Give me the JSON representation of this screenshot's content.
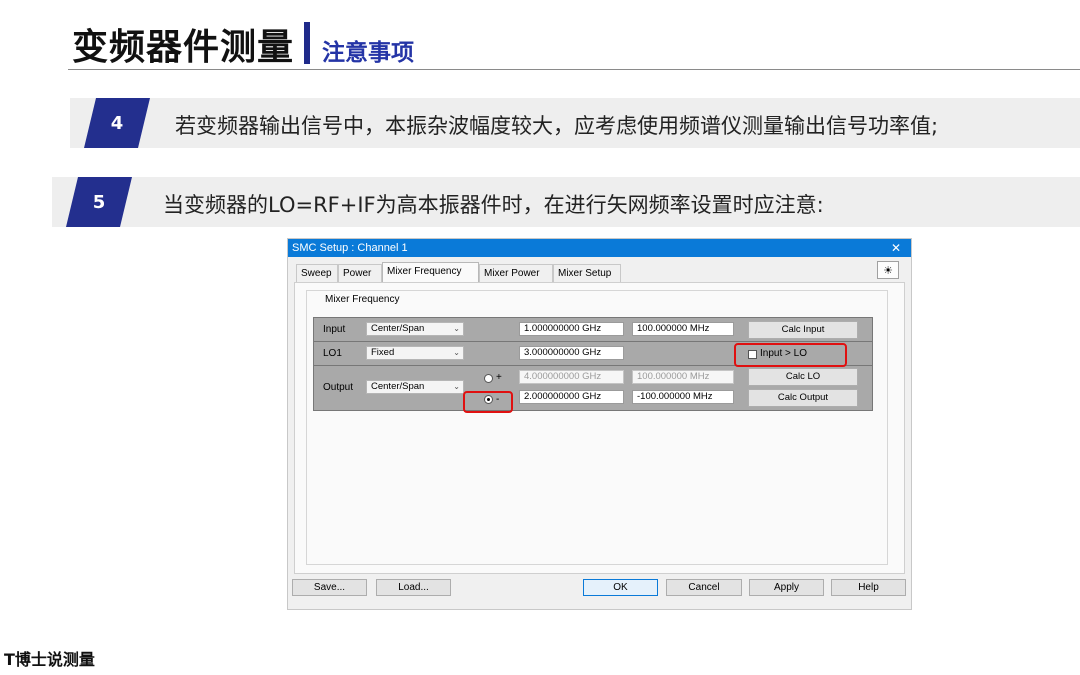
{
  "slide": {
    "title": "变频器件测量",
    "subtitle": "注意事项",
    "notes": [
      {
        "number": "4",
        "text": "若变频器输出信号中，本振杂波幅度较大，应考虑使用频谱仪测量输出信号功率值;"
      },
      {
        "number": "5",
        "text": "当变频器的LO=RF+IF为高本振器件时，在进行矢网频率设置时应注意:"
      }
    ],
    "watermark": "T博士说测量"
  },
  "dialog": {
    "title": "SMC Setup : Channel 1",
    "close_glyph": "✕",
    "tabs": [
      "Sweep",
      "Power",
      "Mixer Frequency",
      "Mixer Power",
      "Mixer Setup"
    ],
    "active_tab": "Mixer Frequency",
    "sun_icon": "☀",
    "group_label": "Mixer Frequency",
    "input": {
      "label": "Input",
      "mode": "Center/Span",
      "center": "1.000000000 GHz",
      "span": "100.000000 MHz",
      "calc_button": "Calc Input"
    },
    "lo1": {
      "label": "LO1",
      "mode": "Fixed",
      "freq": "3.000000000 GHz",
      "checkbox_label": "Input > LO",
      "checkbox_checked": false
    },
    "output": {
      "label": "Output",
      "mode": "Center/Span",
      "plus_label": "+",
      "minus_label": "-",
      "selected_sign": "-",
      "plus_center": "4.000000000 GHz",
      "plus_span": "100.000000 MHz",
      "minus_center": "2.000000000 GHz",
      "minus_span": "-100.000000 MHz",
      "calc_lo_button": "Calc LO",
      "calc_output_button": "Calc Output"
    },
    "buttons": {
      "save": "Save...",
      "load": "Load...",
      "ok": "OK",
      "cancel": "Cancel",
      "apply": "Apply",
      "help": "Help"
    },
    "highlight_color": "#e01010",
    "accent": "#0a7ad8"
  }
}
